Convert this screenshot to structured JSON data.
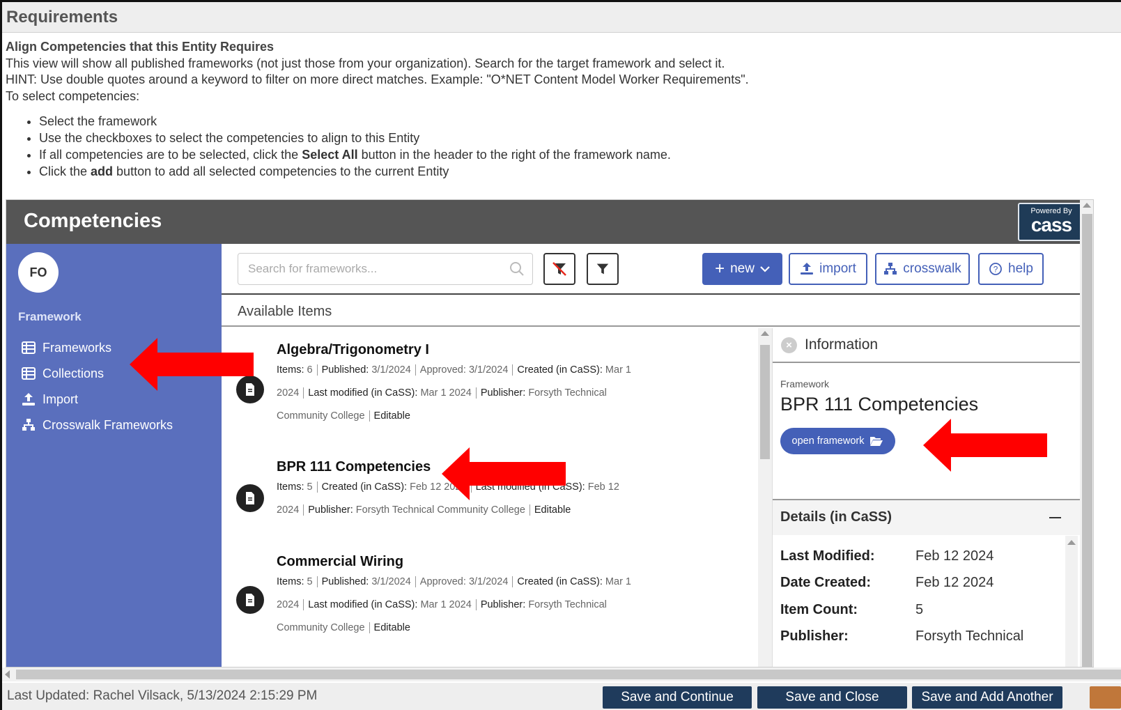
{
  "page": {
    "header_title": "Requirements",
    "instructions": {
      "title": "Align Competencies that this Entity Requires",
      "line1": "This view will show all published frameworks (not just those from your organization). Search for the target framework and select it.",
      "line2": "HINT: Use double quotes around a keyword to filter on more direct matches. Example: \"O*NET Content Model Worker Requirements\".",
      "line3": "To select competencies:",
      "bullet1": "Select the framework",
      "bullet2": "Use the checkboxes to select the competencies to align to this Entity",
      "bullet3_pre": "If all competencies are to be selected, click the ",
      "bullet3_bold": "Select All",
      "bullet3_post": " button in the header to the right of the framework name.",
      "bullet4_pre": "Click the ",
      "bullet4_bold": "add",
      "bullet4_post": " button to add all selected competencies to the current Entity"
    }
  },
  "app": {
    "title": "Competencies",
    "badge_powered": "Powered By",
    "badge_logo": "cass",
    "avatar": "FO",
    "sidebar": {
      "section": "Framework",
      "items": [
        {
          "label": "Frameworks",
          "icon": "table-icon"
        },
        {
          "label": "Collections",
          "icon": "table-icon"
        },
        {
          "label": "Import",
          "icon": "upload-icon"
        },
        {
          "label": "Crosswalk Frameworks",
          "icon": "sitemap-icon"
        }
      ]
    },
    "toolbar": {
      "search_placeholder": "Search for frameworks...",
      "new_label": "new",
      "import_label": "import",
      "crosswalk_label": "crosswalk",
      "help_label": "help"
    },
    "available_items": "Available Items",
    "frameworks": [
      {
        "title": "Algebra/Trigonometry I",
        "meta": [
          {
            "k": "Items:",
            "v": "6"
          },
          {
            "k": "Published:",
            "v": "3/1/2024"
          },
          {
            "k": "Approved:",
            "v": "3/1/2024"
          },
          {
            "k": "Created (in CaSS):",
            "v": "Mar 1 2024"
          },
          {
            "k": "Last modified (in CaSS):",
            "v": "Mar 1 2024"
          },
          {
            "k": "Publisher:",
            "v": "Forsyth Technical Community College"
          },
          {
            "k": "Editable",
            "v": ""
          }
        ]
      },
      {
        "title": "BPR 111 Competencies",
        "meta": [
          {
            "k": "Items:",
            "v": "5"
          },
          {
            "k": "Created (in CaSS):",
            "v": "Feb 12 2024"
          },
          {
            "k": "Last modified (in CaSS):",
            "v": "Feb 12 2024"
          },
          {
            "k": "Publisher:",
            "v": "Forsyth Technical Community College"
          },
          {
            "k": "Editable",
            "v": ""
          }
        ]
      },
      {
        "title": "Commercial Wiring",
        "meta": [
          {
            "k": "Items:",
            "v": "5"
          },
          {
            "k": "Published:",
            "v": "3/1/2024"
          },
          {
            "k": "Approved:",
            "v": "3/1/2024"
          },
          {
            "k": "Created (in CaSS):",
            "v": "Mar 1 2024"
          },
          {
            "k": "Last modified (in CaSS):",
            "v": "Mar 1 2024"
          },
          {
            "k": "Publisher:",
            "v": "Forsyth Technical Community College"
          },
          {
            "k": "Editable",
            "v": ""
          }
        ]
      }
    ],
    "info": {
      "title": "Information",
      "label": "Framework",
      "name": "BPR 111 Competencies",
      "open_button": "open framework",
      "details_title": "Details (in CaSS)",
      "details": [
        {
          "k": "Last Modified:",
          "v": "Feb 12 2024"
        },
        {
          "k": "Date Created:",
          "v": "Feb 12 2024"
        },
        {
          "k": "Item Count:",
          "v": "5"
        },
        {
          "k": "Publisher:",
          "v": "Forsyth Technical"
        }
      ]
    }
  },
  "footer": {
    "last_updated": "Last Updated: Rachel Vilsack, 5/13/2024 2:15:29 PM",
    "save_continue": "Save and Continue",
    "save_close": "Save and Close",
    "save_add": "Save and Add Another"
  },
  "colors": {
    "sidebar": "#5a6fbd",
    "accent": "#4460b8",
    "header_bar": "#555555",
    "footer_button": "#1f3b5c",
    "arrow": "#ff0000"
  }
}
